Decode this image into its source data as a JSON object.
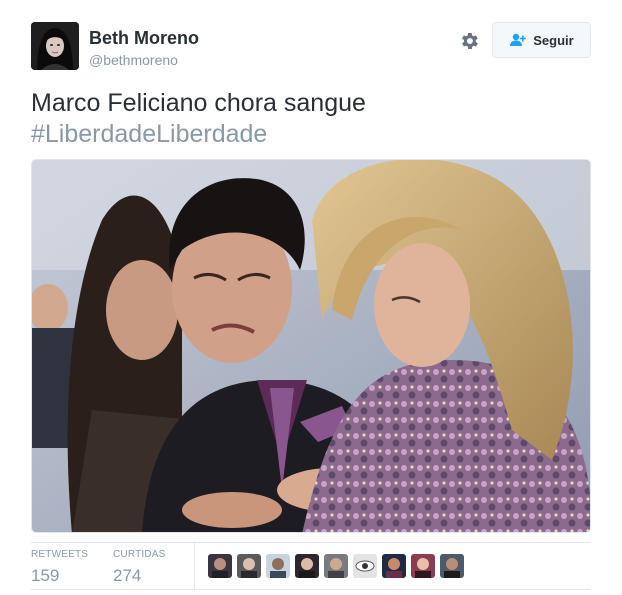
{
  "author": {
    "name": "Beth Moreno",
    "handle": "@bethmoreno",
    "avatar_icon": "user-avatar"
  },
  "actions": {
    "follow_label": "Seguir",
    "follow_icon": "add-user-icon",
    "settings_icon": "gear-icon"
  },
  "tweet": {
    "text": "Marco Feliciano chora sangue",
    "hashtag": "#LiberdadeLiberdade"
  },
  "media": {
    "kind": "photo"
  },
  "stats": {
    "retweets_label": "RETWEETS",
    "retweets_count": "159",
    "likes_label": "CURTIDAS",
    "likes_count": "274"
  },
  "likers": [
    "liker-1",
    "liker-2",
    "liker-3",
    "liker-4",
    "liker-5",
    "liker-6",
    "liker-7",
    "liker-8",
    "liker-9"
  ],
  "colors": {
    "text": "#292f33",
    "muted": "#8899a6",
    "border": "#e1e8ed",
    "follow_icon": "#1da1f2"
  }
}
